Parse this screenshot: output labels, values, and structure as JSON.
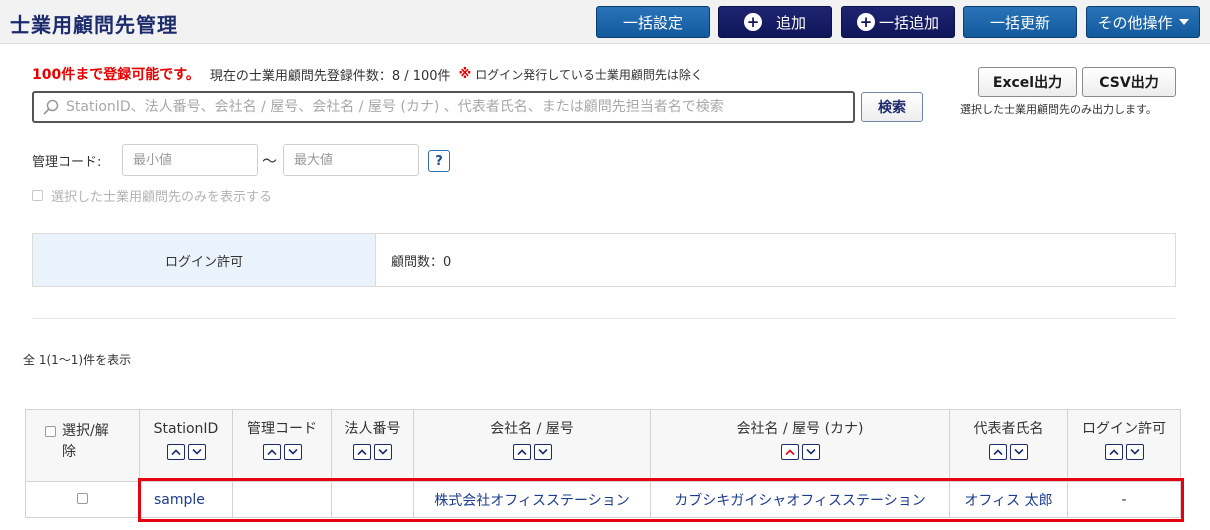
{
  "header": {
    "title": "士業用顧問先管理",
    "buttons": {
      "bulk_settings": "一括設定",
      "add": "追加",
      "bulk_add": "一括追加",
      "bulk_update": "一括更新",
      "other_actions": "その他操作"
    }
  },
  "registration": {
    "limit_text": "100件まで登録可能です。",
    "count_text": "現在の士業用顧問先登録件数：8 / 100件",
    "note_mark": "※",
    "note_text": "ログイン発行している士業用顧問先は除く"
  },
  "search": {
    "placeholder": "StationID、法人番号、会社名 / 屋号、会社名 / 屋号 (カナ) 、代表者氏名、または顧問先担当者名で検索",
    "button": "検索"
  },
  "export": {
    "excel": "Excel出力",
    "csv": "CSV出力",
    "note": "選択した士業用顧問先のみ出力します。"
  },
  "filter": {
    "code_label": "管理コード:",
    "min_placeholder": "最小値",
    "tilde": "～",
    "max_placeholder": "最大値",
    "help": "?",
    "only_selected": "選択した士業用顧問先のみを表示する"
  },
  "summary": {
    "label": "ログイン許可",
    "value": "顧問数：0"
  },
  "results": {
    "count_text": "全 1(1～1)件を表示"
  },
  "table": {
    "columns": [
      "選択/解除",
      "StationID",
      "管理コード",
      "法人番号",
      "会社名 / 屋号",
      "会社名 / 屋号 (カナ)",
      "代表者氏名",
      "ログイン許可"
    ],
    "rows": [
      {
        "station_id": "sample",
        "management_code": "",
        "corporate_number": "",
        "company_name": "株式会社オフィスステーション",
        "company_name_kana": "カブシキガイシャオフィスステーション",
        "representative": "オフィス 太郎",
        "login_allowed": "-"
      }
    ]
  },
  "colors": {
    "title": "#1c2b6b",
    "primary_button": "#125a9c",
    "navy_button": "#10165a",
    "alert_red": "#e60000",
    "summary_bg": "#eaf2fb",
    "link": "#1c3c8e",
    "highlight": "#e60012",
    "sort_active": "#e60012"
  },
  "icons": {
    "search": "search-icon",
    "add": "plus-circle-icon",
    "dropdown": "caret-down-icon",
    "sort_asc": "chevron-up-icon",
    "sort_desc": "chevron-down-icon",
    "help": "question-icon"
  }
}
